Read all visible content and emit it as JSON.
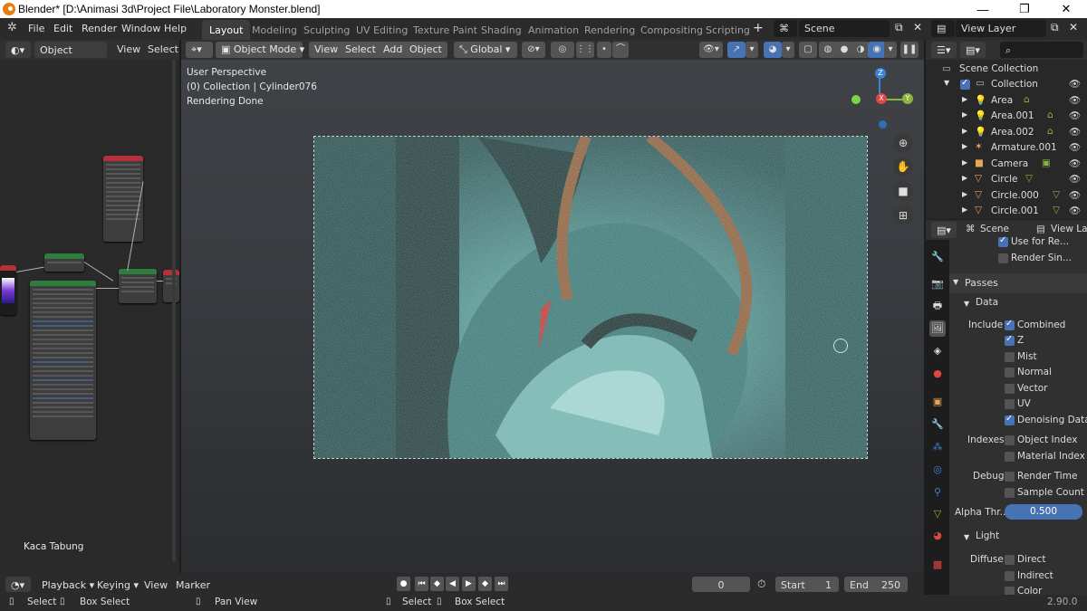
{
  "window": {
    "title": "Blender* [D:\\Animasi 3d\\Project File\\Laboratory Monster.blend]",
    "minimize": "—",
    "maximize": "❐",
    "close": "✕"
  },
  "menu": {
    "items": [
      "File",
      "Edit",
      "Render",
      "Window",
      "Help"
    ]
  },
  "workspaces": [
    "Layout",
    "Modeling",
    "Sculpting",
    "UV Editing",
    "Texture Paint",
    "Shading",
    "Animation",
    "Rendering",
    "Compositing",
    "Scripting"
  ],
  "scene": {
    "name": "Scene",
    "view_layer": "View Layer",
    "add_tab": "+"
  },
  "node_editor": {
    "type_label": "Object",
    "view": "View",
    "select": "Select",
    "material_label": "Kaca Tabung"
  },
  "viewport": {
    "mode": "Object Mode",
    "menus": [
      "View",
      "Select",
      "Add",
      "Object"
    ],
    "orientation": "Global",
    "overlay_lines": [
      "User Perspective",
      "(0) Collection | Cylinder076",
      "Rendering Done"
    ],
    "gizmo": {
      "x": "X",
      "y": "Y",
      "z": "Z"
    }
  },
  "outliner": {
    "root": "Scene Collection",
    "collection": "Collection",
    "items": [
      "Area",
      "Area.001",
      "Area.002",
      "Armature.001",
      "Camera",
      "Circle",
      "Circle.000",
      "Circle.001"
    ]
  },
  "properties": {
    "scene": "Scene",
    "view_layer": "View La",
    "use_for_render": "Use for Re...",
    "render_single": "Render Sin...",
    "passes": "Passes",
    "data": "Data",
    "include": "Include",
    "include_items": [
      {
        "label": "Combined",
        "checked": true
      },
      {
        "label": "Z",
        "checked": true
      },
      {
        "label": "Mist",
        "checked": false
      },
      {
        "label": "Normal",
        "checked": false
      },
      {
        "label": "Vector",
        "checked": false
      },
      {
        "label": "UV",
        "checked": false
      },
      {
        "label": "Denoising Data",
        "checked": true
      }
    ],
    "indexes": "Indexes",
    "index_items": [
      {
        "label": "Object Index",
        "checked": false
      },
      {
        "label": "Material Index",
        "checked": false
      }
    ],
    "debug": "Debug",
    "debug_items": [
      {
        "label": "Render Time",
        "checked": false
      },
      {
        "label": "Sample Count",
        "checked": false
      }
    ],
    "alpha_label": "Alpha Thr...",
    "alpha_value": "0.500",
    "light": "Light",
    "diffuse": "Diffuse",
    "diffuse_items": [
      {
        "label": "Direct",
        "checked": false
      },
      {
        "label": "Indirect",
        "checked": false
      },
      {
        "label": "Color",
        "checked": false
      }
    ]
  },
  "timeline": {
    "playback": "Playback",
    "keying": "Keying",
    "view": "View",
    "marker": "Marker",
    "current_frame": "0",
    "start_label": "Start",
    "start": "1",
    "end_label": "End",
    "end": "250"
  },
  "statusbar": {
    "select": "Select",
    "box_select": "Box Select",
    "pan_view": "Pan View",
    "select2": "Select",
    "box_select2": "Box Select",
    "version": "2.90.0"
  },
  "colors": {
    "accent": "#4772b3",
    "active_tab": "#3d3d3d",
    "render_teal": "#2f7a78",
    "gizmo_x": "#e04646",
    "gizmo_y": "#8ab33f",
    "gizmo_z": "#3b83d6"
  }
}
